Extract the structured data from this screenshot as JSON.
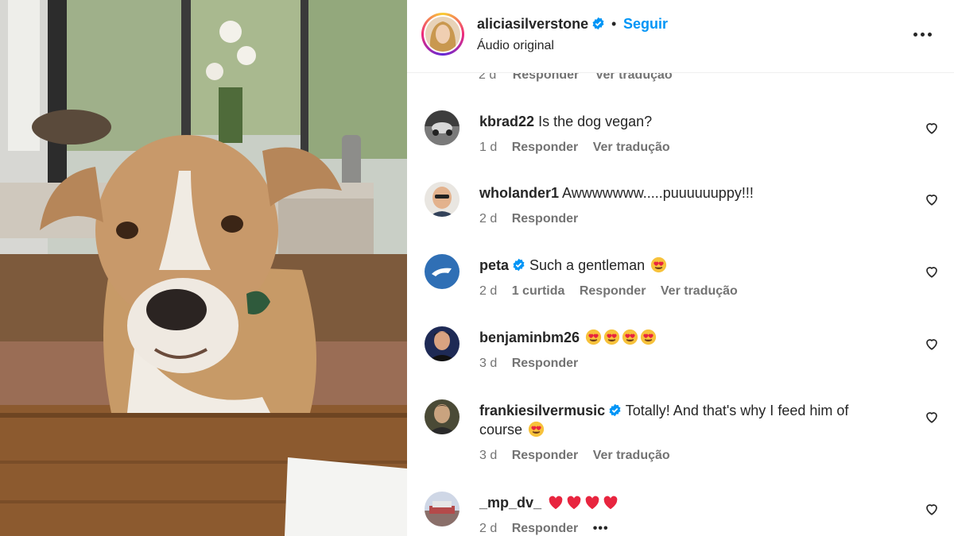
{
  "post": {
    "username": "aliciasilverstone",
    "separator": "•",
    "follow_label": "Seguir",
    "audio_label": "Áudio original"
  },
  "partial_row": {
    "age": "2 d",
    "reply_label": "Responder",
    "translate_label": "Ver tradução"
  },
  "comments": [
    {
      "username": "kbrad22",
      "text": "Is the dog vegan?",
      "age": "1 d",
      "reply_label": "Responder",
      "translate_label": "Ver tradução"
    },
    {
      "username": "wholander1",
      "text": "Awwwwwww.....puuuuuuppy!!!",
      "age": "2 d",
      "reply_label": "Responder"
    },
    {
      "username": "peta",
      "text": "Such a gentleman",
      "age": "2 d",
      "likes": "1 curtida",
      "reply_label": "Responder",
      "translate_label": "Ver tradução"
    },
    {
      "username": "benjaminbm26",
      "text": "",
      "age": "3 d",
      "reply_label": "Responder"
    },
    {
      "username": "frankiesilvermusic",
      "text": "Totally! And that's why I feed him of course",
      "age": "3 d",
      "reply_label": "Responder",
      "translate_label": "Ver tradução"
    },
    {
      "username": "_mp_dv_",
      "text": "",
      "age": "2 d",
      "reply_label": "Responder",
      "more": "•••"
    }
  ],
  "icons": {
    "verified": "verified-badge-icon",
    "like": "heart-outline-icon",
    "more": "more-horizontal-icon",
    "heart_eyes": "heart-eyes-emoji-icon",
    "red_heart": "red-heart-emoji-icon"
  },
  "colors": {
    "link_blue": "#0095f6",
    "verified_blue": "#0095f6",
    "muted_text": "#737373",
    "text": "#262626"
  }
}
